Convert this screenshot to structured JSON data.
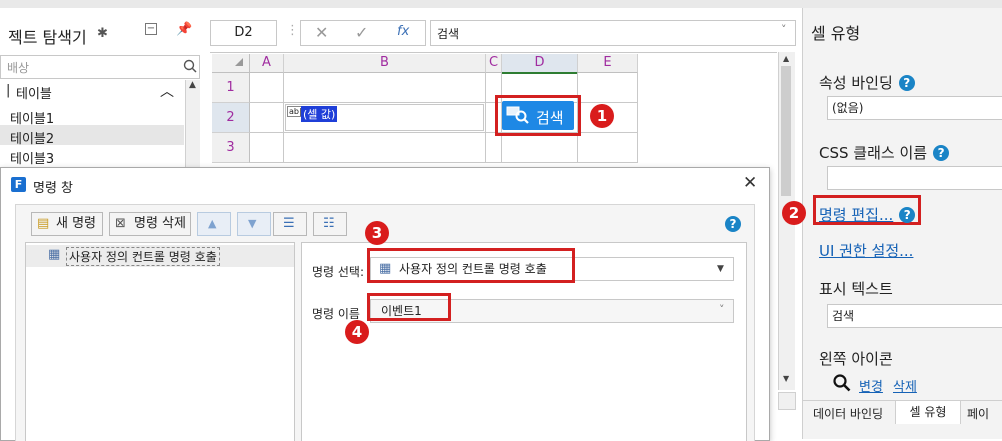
{
  "explorer": {
    "title": "젝트 탐색기",
    "search_placeholder": "배상",
    "tree_root": "테이블",
    "tree_items": [
      "테이블1",
      "테이블2",
      "테이블3"
    ]
  },
  "formula_bar": {
    "cell_ref": "D2",
    "fx": "fx",
    "value": "검색"
  },
  "grid": {
    "columns": [
      "A",
      "B",
      "C",
      "D",
      "E"
    ],
    "rows": [
      "1",
      "2",
      "3"
    ],
    "b2_text": "(셀 값)",
    "b2_icon": "ab|",
    "button_label": "검색"
  },
  "right_panel": {
    "title": "셀 유형",
    "binding_label": "속성 바인딩",
    "binding_value": "(없음)",
    "css_label": "CSS 클래스 이름",
    "edit_command_link": "명령 편집...",
    "ui_permission_link": "UI 권한 설정...",
    "display_text_label": "표시 텍스트",
    "display_text_value": "검색",
    "left_icon_label": "왼쪽 아이콘",
    "change_link": "변경",
    "delete_link": "삭제",
    "tabs": [
      "데이터 바인딩",
      "셀 유형",
      "페이"
    ]
  },
  "dialog": {
    "title": "명령 창",
    "new_command": "새 명령",
    "delete_command": "명령 삭제",
    "list_item": "사용자 정의 컨트롤 명령 호출",
    "command_select_label": "명령 선택:",
    "command_select_value": "사용자 정의 컨트롤 명령 호출",
    "command_name_label": "명령 이름",
    "command_name_value": "이벤트1"
  },
  "badges": [
    "1",
    "2",
    "3",
    "4"
  ],
  "colors": {
    "accent_blue": "#1e88e5",
    "badge_red": "#d91c1c",
    "header_pink": "#a02ca0"
  }
}
